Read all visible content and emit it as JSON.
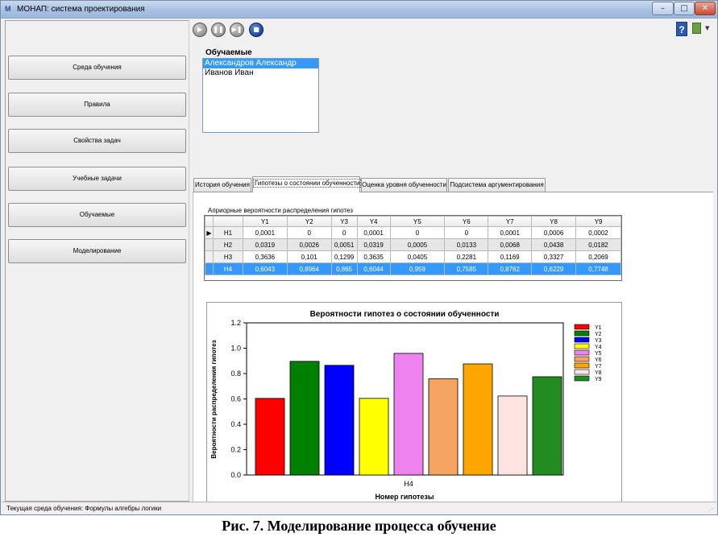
{
  "window": {
    "title": "МОНАП: система проектирования",
    "icon": "app-icon"
  },
  "window_controls": {
    "minimize": "–",
    "maximize": "□",
    "close": "✕"
  },
  "nav": [
    {
      "label": "Среда обучения"
    },
    {
      "label": "Правила"
    },
    {
      "label": "Свойства задач"
    },
    {
      "label": "Учебные задачи"
    },
    {
      "label": "Обучаемые"
    },
    {
      "label": "Моделирование"
    }
  ],
  "player": {
    "play": "▶",
    "pause": "❚❚",
    "step": "▶❚",
    "stop": "■"
  },
  "toolbar_right": {
    "help": "?",
    "caret": "▼"
  },
  "learners": {
    "title": "Обучаемые",
    "items": [
      "Александров Александр",
      "Иванов Иван"
    ],
    "selected": 0
  },
  "tabs": [
    {
      "label": "История обучения",
      "active": false
    },
    {
      "label": "Гипотезы о состоянии обученности",
      "active": true
    },
    {
      "label": "Оценка уровня обученности",
      "active": false
    },
    {
      "label": "Подсистема аргументирования",
      "active": false
    }
  ],
  "table": {
    "caption": "Априорные вероятности распределения гипотез",
    "columns": [
      "Y1",
      "Y2",
      "Y3",
      "Y4",
      "Y5",
      "Y6",
      "Y7",
      "Y8",
      "Y9"
    ],
    "rows": [
      {
        "name": "H1",
        "current": true,
        "values": [
          "0,0001",
          "0",
          "0",
          "0,0001",
          "0",
          "0",
          "0,0001",
          "0,0006",
          "0,0002"
        ]
      },
      {
        "name": "H2",
        "values": [
          "0,0319",
          "0,0026",
          "0,0051",
          "0,0319",
          "0,0005",
          "0,0133",
          "0,0068",
          "0,0438",
          "0,0182"
        ]
      },
      {
        "name": "H3",
        "values": [
          "0,3636",
          "0,101",
          "0,1299",
          "0,3635",
          "0,0405",
          "0,2281",
          "0,1169",
          "0,3327",
          "0,2069"
        ]
      },
      {
        "name": "H4",
        "selected": true,
        "values": [
          "0,6043",
          "0,8964",
          "0,865",
          "0,6044",
          "0,959",
          "0,7585",
          "0,8762",
          "0,6229",
          "0,7748"
        ]
      }
    ],
    "row_marker": "▶"
  },
  "chart_data": {
    "type": "bar",
    "title": "Вероятности гипотез о состоянии обученности",
    "xlabel": "Номер гипотезы",
    "ylabel": "Вероятности распределения гипотез",
    "categories": [
      "H4"
    ],
    "series": [
      {
        "name": "Y1",
        "values": [
          0.6043
        ],
        "color": "#ff0000"
      },
      {
        "name": "Y2",
        "values": [
          0.8964
        ],
        "color": "#008000"
      },
      {
        "name": "Y3",
        "values": [
          0.865
        ],
        "color": "#0000ff"
      },
      {
        "name": "Y4",
        "values": [
          0.6044
        ],
        "color": "#ffff00"
      },
      {
        "name": "Y5",
        "values": [
          0.959
        ],
        "color": "#ee82ee"
      },
      {
        "name": "Y6",
        "values": [
          0.7585
        ],
        "color": "#f4a460"
      },
      {
        "name": "Y7",
        "values": [
          0.8762
        ],
        "color": "#ffa500"
      },
      {
        "name": "Y8",
        "values": [
          0.6229
        ],
        "color": "#ffe4e1"
      },
      {
        "name": "Y9",
        "values": [
          0.7748
        ],
        "color": "#228b22"
      }
    ],
    "ylim": [
      0,
      1.2
    ],
    "yticks": [
      "0.0",
      "0.2",
      "0.4",
      "0.6",
      "0.8",
      "1.0",
      "1.2"
    ],
    "legend": "right",
    "grid": false
  },
  "status": {
    "text": "Текущая среда обучения:  Формулы алгебры логики",
    "grip": "⋰"
  },
  "caption": "Рис. 7. Моделирование процесса обучение"
}
